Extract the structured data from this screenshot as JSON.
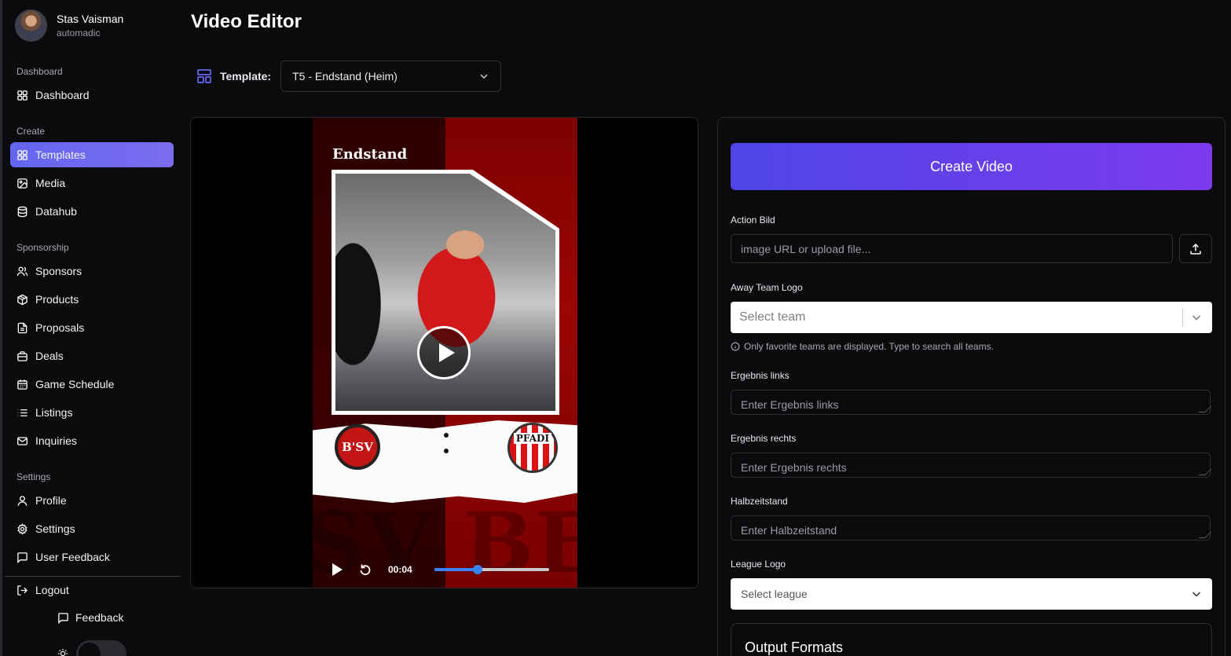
{
  "user": {
    "name": "Stas Vaisman",
    "org": "automadic"
  },
  "sidebar": {
    "sections": {
      "dashboard": "Dashboard",
      "create": "Create",
      "sponsorship": "Sponsorship",
      "settings": "Settings"
    },
    "items": {
      "dashboard": "Dashboard",
      "templates": "Templates",
      "media": "Media",
      "datahub": "Datahub",
      "sponsors": "Sponsors",
      "products": "Products",
      "proposals": "Proposals",
      "deals": "Deals",
      "game_schedule": "Game Schedule",
      "listings": "Listings",
      "inquiries": "Inquiries",
      "profile": "Profile",
      "settings": "Settings",
      "user_feedback": "User Feedback",
      "logout": "Logout"
    },
    "active_item": "Templates",
    "feedback": "Feedback"
  },
  "header": {
    "title": "Video Editor",
    "template_label": "Template:",
    "template_value": "T5 - Endstand (Heim)"
  },
  "preview": {
    "video_title": "Endstand",
    "home_logo_text": "B'SV",
    "away_logo_text": "PFADI",
    "background_text": "SV BEI",
    "time": "00:04",
    "progress_fraction": 0.38
  },
  "form": {
    "create_button": "Create Video",
    "action_bild_label": "Action Bild",
    "action_bild_placeholder": "image URL or upload file...",
    "away_team_label": "Away Team Logo",
    "away_team_placeholder": "Select team",
    "away_team_hint": "Only favorite teams are displayed. Type to search all teams.",
    "ergebnis_links_label": "Ergebnis links",
    "ergebnis_links_placeholder": "Enter Ergebnis links",
    "ergebnis_rechts_label": "Ergebnis rechts",
    "ergebnis_rechts_placeholder": "Enter Ergebnis rechts",
    "halbzeit_label": "Halbzeitstand",
    "halbzeit_placeholder": "Enter Halbzeitstand",
    "league_label": "League Logo",
    "league_placeholder": "Select league",
    "output_title": "Output Formats"
  },
  "colors": {
    "accent": "#6366f1",
    "create_gradient_start": "#4f46e5",
    "create_gradient_end": "#7c3aed",
    "progress": "#3b82f6",
    "background": "#0b0b0d"
  },
  "icons": {
    "dashboard": "grid-icon",
    "templates": "grid-icon",
    "media": "image-icon",
    "datahub": "database-icon",
    "sponsors": "users-icon",
    "products": "package-icon",
    "proposals": "file-text-icon",
    "deals": "briefcase-icon",
    "game_schedule": "calendar-icon",
    "listings": "list-icon",
    "inquiries": "mail-icon",
    "profile": "user-icon",
    "settings": "gear-icon",
    "user_feedback": "message-square-icon",
    "logout": "logout-icon"
  }
}
